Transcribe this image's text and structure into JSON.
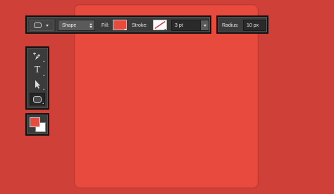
{
  "options_bar": {
    "tool_preset_icon": "rounded-rectangle-icon",
    "tool_mode": "Shape",
    "fill_label": "Fill:",
    "fill_color": "#e84a3e",
    "stroke_label": "Stroke:",
    "stroke_color": "none",
    "stroke_width": "3 pt"
  },
  "radius_bar": {
    "label": "Radius:",
    "value": "10 px"
  },
  "toolbox": {
    "tools": [
      {
        "name": "pen-tool",
        "icon": "pen-plus-icon"
      },
      {
        "name": "type-tool",
        "icon": "type-icon",
        "glyph": "T"
      },
      {
        "name": "path-selection-tool",
        "icon": "arrow-cursor-icon"
      },
      {
        "name": "rounded-rectangle-tool",
        "icon": "rounded-rectangle-icon",
        "active": true
      }
    ]
  },
  "colors": {
    "foreground": "#e84a3e",
    "background": "#ffffff",
    "canvas_background": "#cf4138",
    "shape_fill": "#e84a3e"
  }
}
